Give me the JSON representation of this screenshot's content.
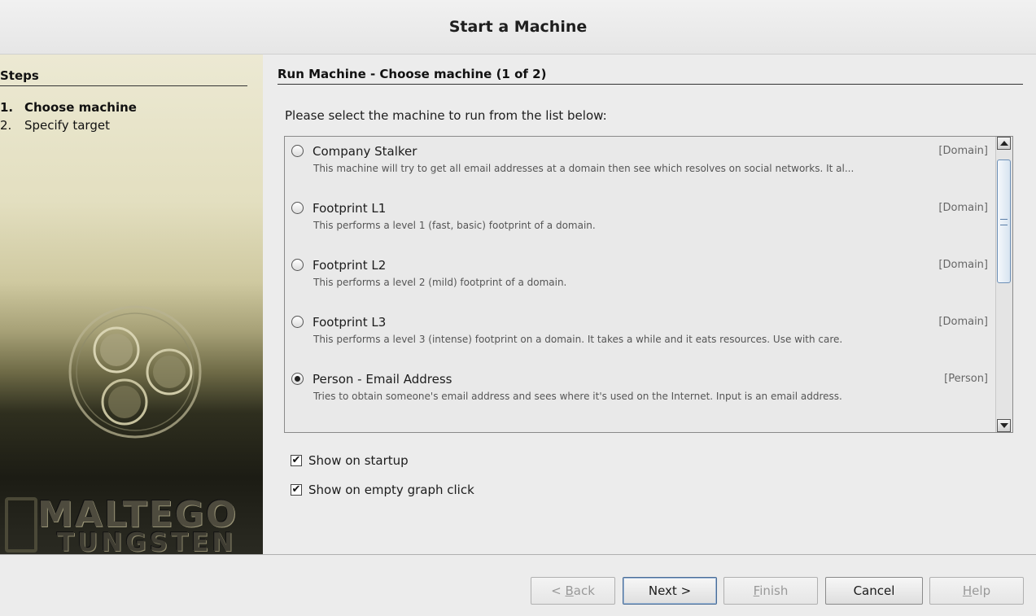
{
  "window": {
    "title": "Start a Machine"
  },
  "sidebar": {
    "heading": "Steps",
    "steps": [
      {
        "num": "1.",
        "label": "Choose machine"
      },
      {
        "num": "2.",
        "label": "Specify target"
      }
    ],
    "brand_line1": "MALTEGO",
    "brand_line2": "TUNGSTEN"
  },
  "main": {
    "heading": "Run Machine - Choose machine (1 of 2)",
    "instructions": "Please select the machine to run from the list below:",
    "machines": [
      {
        "name": "Company Stalker",
        "type": "[Domain]",
        "description": "This machine will try to get all email addresses at a domain then see which resolves on social networks. It al...",
        "selected": false
      },
      {
        "name": "Footprint L1",
        "type": "[Domain]",
        "description": "This performs a level 1 (fast, basic) footprint of a domain.",
        "selected": false
      },
      {
        "name": "Footprint L2",
        "type": "[Domain]",
        "description": "This performs a level 2 (mild) footprint of a domain.",
        "selected": false
      },
      {
        "name": "Footprint L3",
        "type": "[Domain]",
        "description": "This performs a level 3 (intense) footprint on a domain. It takes a while and it eats resources. Use with care.",
        "selected": false
      },
      {
        "name": "Person - Email Address",
        "type": "[Person]",
        "description": "Tries to obtain someone's email address and sees where it's used on the Internet. Input is an email address.",
        "selected": true
      }
    ],
    "options": [
      {
        "label": "Show on startup",
        "checked": true
      },
      {
        "label": "Show on empty graph click",
        "checked": true
      }
    ]
  },
  "buttons": {
    "back": {
      "prefix": "< ",
      "mnemonic": "B",
      "rest": "ack"
    },
    "next": {
      "label": "Next >"
    },
    "finish": {
      "mnemonic": "F",
      "rest": "inish"
    },
    "cancel": {
      "label": "Cancel"
    },
    "help": {
      "mnemonic": "H",
      "rest": "elp"
    }
  }
}
